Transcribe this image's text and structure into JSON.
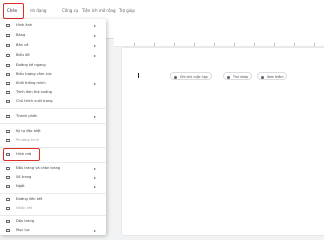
{
  "menubar": {
    "insert": "Chèn",
    "format_partial": "nh dạng",
    "tools": "Công cụ",
    "extensions": "Tiện ích mở rộng",
    "help": "Trợ giúp"
  },
  "doc": {
    "chips": [
      {
        "label": "Ghi chú cuộc họp",
        "icon": "calendar-icon"
      },
      {
        "label": "Thư nháp",
        "icon": "mail-icon"
      },
      {
        "label": "Xem thêm",
        "icon": "at-icon"
      }
    ]
  },
  "insert_menu": {
    "items": [
      {
        "label": "Hình ảnh",
        "icon": "image-icon",
        "submenu": true
      },
      {
        "label": "Bảng",
        "icon": "table-icon",
        "submenu": true
      },
      {
        "label": "Bản vẽ",
        "icon": "drawing-icon",
        "submenu": true
      },
      {
        "label": "Biểu đồ",
        "icon": "chart-icon",
        "submenu": true
      },
      {
        "label": "Đường kẻ ngang",
        "icon": "horizontal-line-icon",
        "submenu": false
      },
      {
        "label": "Biểu tượng cảm xúc",
        "icon": "emoji-icon",
        "submenu": false
      },
      {
        "label": "Khối thông minh",
        "icon": "smart-chip-icon",
        "submenu": true
      },
      {
        "label": "Trình đơn thả xuống",
        "icon": "dropdown-icon",
        "submenu": false
      },
      {
        "label": "Chú thích cuối trang",
        "icon": "footnote-icon",
        "submenu": false
      },
      {
        "label": "Thành phần",
        "icon": "building-blocks-icon",
        "submenu": true
      },
      {
        "label": "Ký tự đặc biệt",
        "icon": "omega-icon",
        "submenu": false
      },
      {
        "label": "Phương trình",
        "icon": "equation-icon",
        "submenu": false
      },
      {
        "label": "Hình mờ",
        "icon": "watermark-icon",
        "submenu": false
      },
      {
        "label": "Đầu trang và chân trang",
        "icon": "header-footer-icon",
        "submenu": true
      },
      {
        "label": "Số trang",
        "icon": "page-number-icon",
        "submenu": true
      },
      {
        "label": "Ngắt",
        "icon": "break-icon",
        "submenu": true
      },
      {
        "label": "Đường liên kết",
        "icon": "link-icon",
        "submenu": false
      },
      {
        "label": "Nhận xét",
        "icon": "comment-icon",
        "submenu": false
      },
      {
        "label": "Dấu trang",
        "icon": "bookmark-icon",
        "submenu": false
      },
      {
        "label": "Mục lục",
        "icon": "toc-icon",
        "submenu": true
      }
    ]
  },
  "colors": {
    "highlight": "#d93025",
    "accent": "#1a73e8"
  }
}
